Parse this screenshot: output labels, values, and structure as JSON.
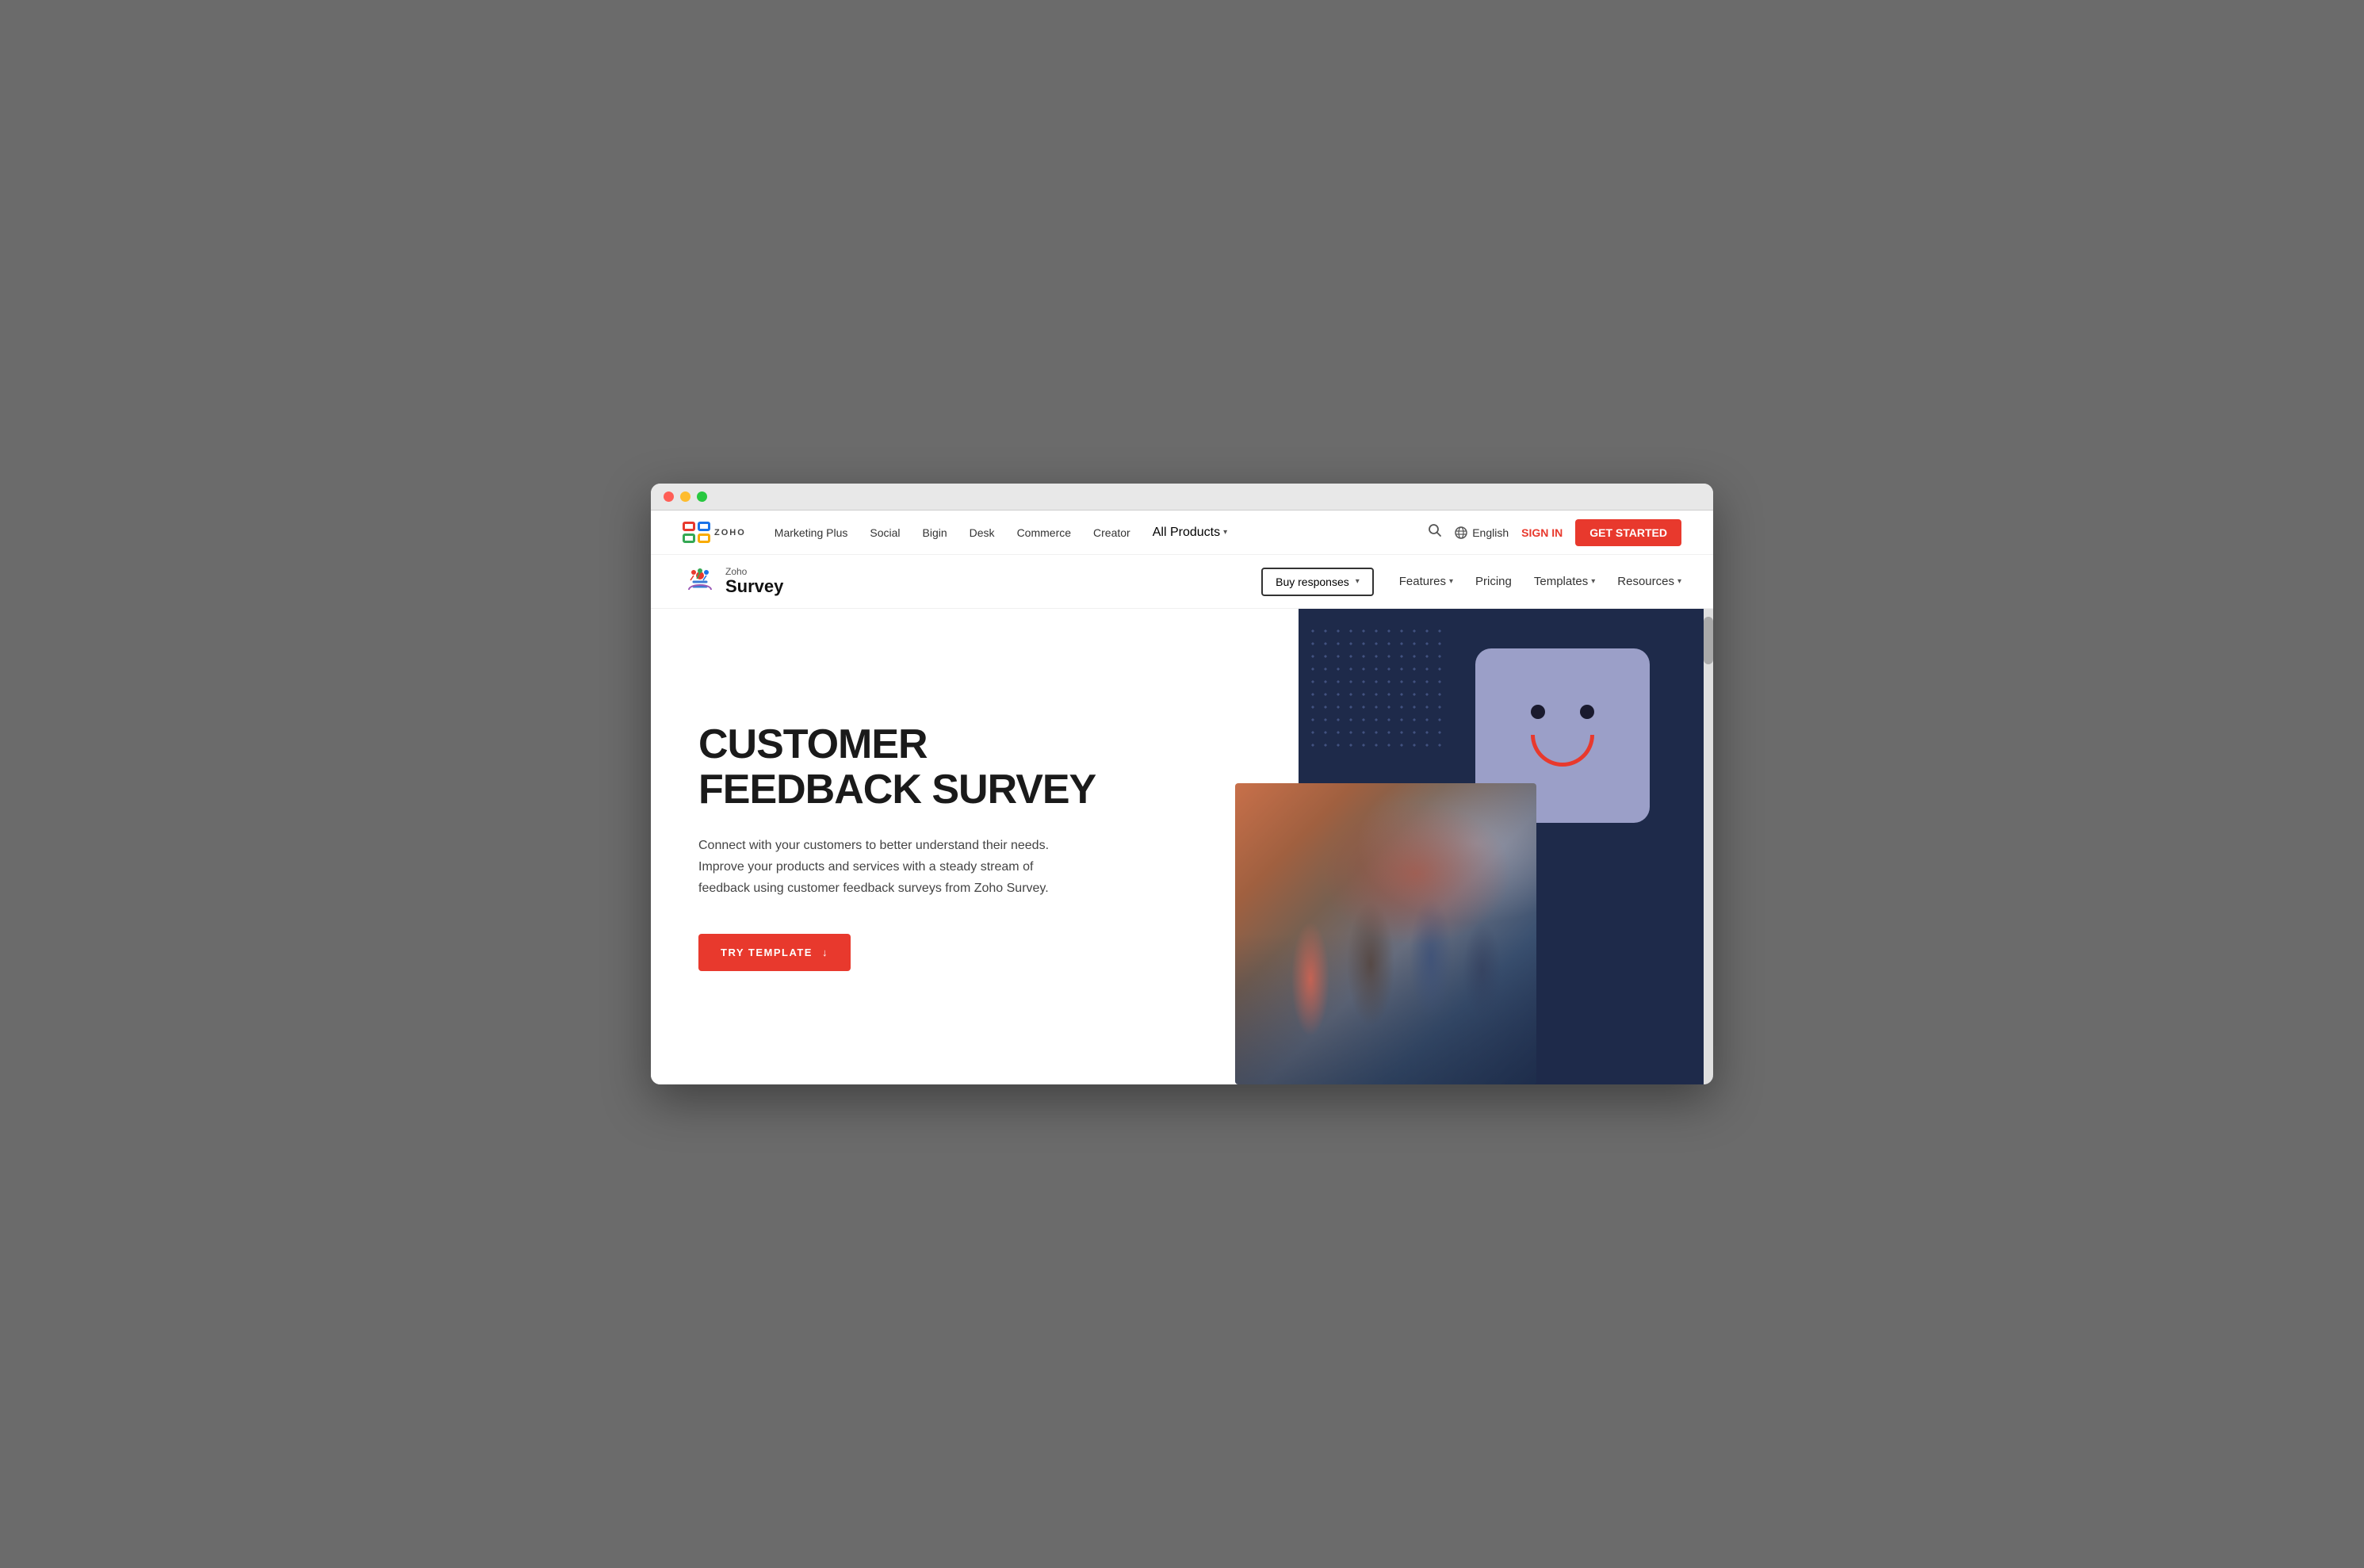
{
  "browser": {
    "traffic_lights": [
      "red",
      "yellow",
      "green"
    ]
  },
  "top_nav": {
    "zoho_text": "ZOHO",
    "links": [
      {
        "label": "Marketing Plus",
        "id": "marketing-plus"
      },
      {
        "label": "Social",
        "id": "social"
      },
      {
        "label": "Bigin",
        "id": "bigin"
      },
      {
        "label": "Desk",
        "id": "desk"
      },
      {
        "label": "Commerce",
        "id": "commerce"
      },
      {
        "label": "Creator",
        "id": "creator"
      },
      {
        "label": "All Products",
        "id": "all-products",
        "has_dropdown": true
      }
    ],
    "language": "English",
    "sign_in": "SIGN IN",
    "get_started": "GET STARTED"
  },
  "survey_nav": {
    "logo_zoho_label": "Zoho",
    "logo_survey_label": "Survey",
    "buy_responses": "Buy responses",
    "nav_links": [
      {
        "label": "Features",
        "has_dropdown": true
      },
      {
        "label": "Pricing",
        "has_dropdown": false
      },
      {
        "label": "Templates",
        "has_dropdown": true
      },
      {
        "label": "Resources",
        "has_dropdown": true
      }
    ]
  },
  "hero": {
    "title_line1": "CUSTOMER",
    "title_line2": "FEEDBACK SURVEY",
    "description": "Connect with your customers to better understand their needs. Improve your products and services with a steady stream of feedback using customer feedback surveys from Zoho Survey.",
    "cta_button": "TRY TEMPLATE",
    "cta_arrow": "↓"
  }
}
